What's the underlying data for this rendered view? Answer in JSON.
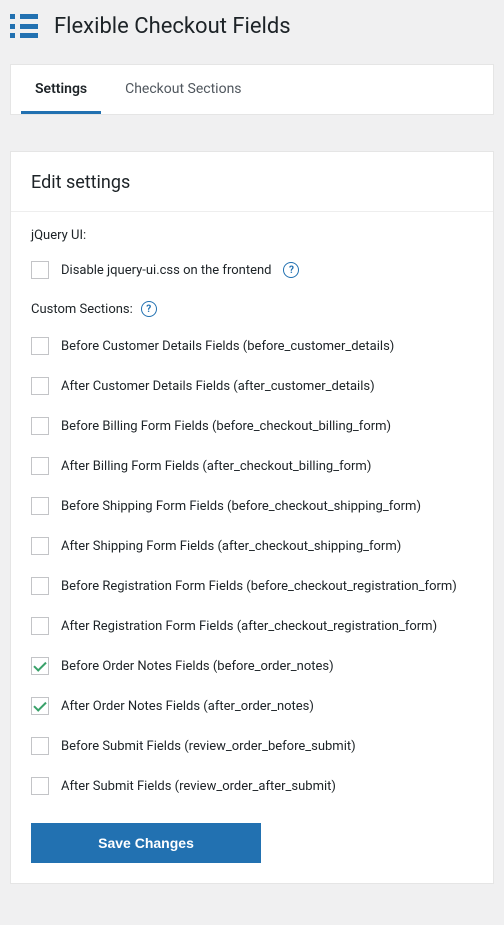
{
  "header": {
    "title": "Flexible Checkout Fields"
  },
  "tabs": {
    "settings": "Settings",
    "checkout_sections": "Checkout Sections"
  },
  "panel": {
    "title": "Edit settings"
  },
  "jquery_section": {
    "label": "jQuery UI:",
    "checkbox_label": "Disable jquery-ui.css on the frontend"
  },
  "custom_sections": {
    "label": "Custom Sections:",
    "items": [
      {
        "label": "Before Customer Details Fields (before_customer_details)",
        "checked": false
      },
      {
        "label": "After Customer Details Fields (after_customer_details)",
        "checked": false
      },
      {
        "label": "Before Billing Form Fields (before_checkout_billing_form)",
        "checked": false
      },
      {
        "label": "After Billing Form Fields (after_checkout_billing_form)",
        "checked": false
      },
      {
        "label": "Before Shipping Form Fields (before_checkout_shipping_form)",
        "checked": false
      },
      {
        "label": "After Shipping Form Fields (after_checkout_shipping_form)",
        "checked": false
      },
      {
        "label": "Before Registration Form Fields (before_checkout_registration_form)",
        "checked": false
      },
      {
        "label": "After Registration Form Fields (after_checkout_registration_form)",
        "checked": false
      },
      {
        "label": "Before Order Notes Fields (before_order_notes)",
        "checked": true
      },
      {
        "label": "After Order Notes Fields (after_order_notes)",
        "checked": true
      },
      {
        "label": "Before Submit Fields (review_order_before_submit)",
        "checked": false
      },
      {
        "label": "After Submit Fields (review_order_after_submit)",
        "checked": false
      }
    ]
  },
  "submit": {
    "label": "Save Changes"
  }
}
